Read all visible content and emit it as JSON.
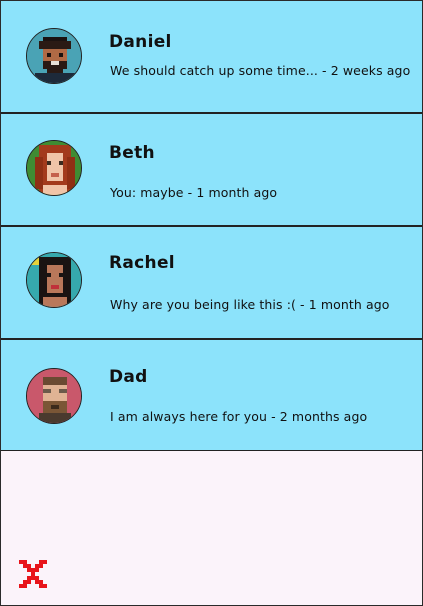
{
  "conversations": [
    {
      "name": "Daniel",
      "preview": "We should catch up some time... - 2 weeks ago",
      "avatar": "daniel-avatar"
    },
    {
      "name": "Beth",
      "preview": "You: maybe -  1 month ago",
      "avatar": "beth-avatar"
    },
    {
      "name": "Rachel",
      "preview": "Why are you being like this :( -  1 month ago",
      "avatar": "rachel-avatar"
    },
    {
      "name": "Dad",
      "preview": "I am always here for you -  2 months ago",
      "avatar": "dad-avatar"
    }
  ],
  "colors": {
    "row_bg": "#8ce3fb",
    "page_bg": "#fbf3fa",
    "close_red": "#e8141b"
  },
  "close_icon": "close-icon"
}
